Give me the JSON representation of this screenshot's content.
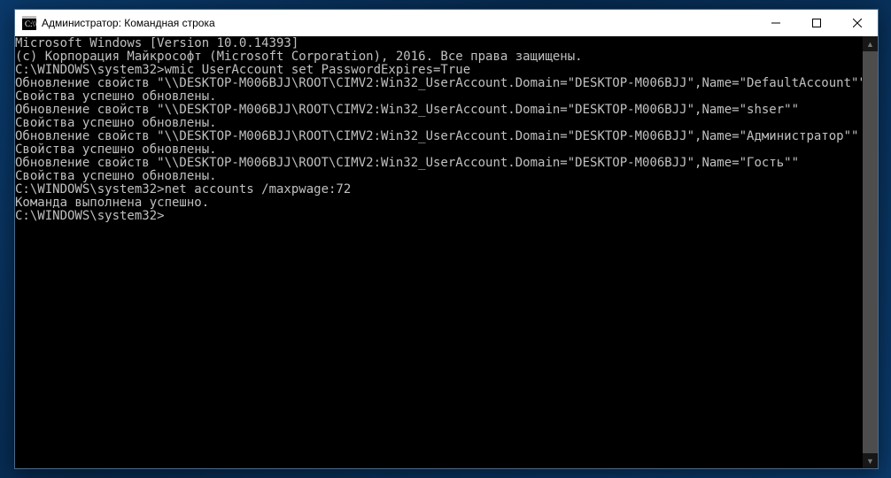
{
  "window": {
    "title": "Администратор: Командная строка"
  },
  "console": {
    "lines": [
      "Microsoft Windows [Version 10.0.14393]",
      "(c) Корпорация Майкрософт (Microsoft Corporation), 2016. Все права защищены.",
      "",
      "C:\\WINDOWS\\system32>wmic UserAccount set PasswordExpires=True",
      "Обновление свойств \"\\\\DESKTOP-M006BJJ\\ROOT\\CIMV2:Win32_UserAccount.Domain=\"DESKTOP-M006BJJ\",Name=\"DefaultAccount\"\"",
      "Свойства успешно обновлены.",
      "Обновление свойств \"\\\\DESKTOP-M006BJJ\\ROOT\\CIMV2:Win32_UserAccount.Domain=\"DESKTOP-M006BJJ\",Name=\"shser\"\"",
      "Свойства успешно обновлены.",
      "Обновление свойств \"\\\\DESKTOP-M006BJJ\\ROOT\\CIMV2:Win32_UserAccount.Domain=\"DESKTOP-M006BJJ\",Name=\"Администратор\"\"",
      "Свойства успешно обновлены.",
      "Обновление свойств \"\\\\DESKTOP-M006BJJ\\ROOT\\CIMV2:Win32_UserAccount.Domain=\"DESKTOP-M006BJJ\",Name=\"Гость\"\"",
      "Свойства успешно обновлены.",
      "",
      "C:\\WINDOWS\\system32>net accounts /maxpwage:72",
      "Команда выполнена успешно.",
      "",
      "",
      "C:\\WINDOWS\\system32>"
    ]
  }
}
